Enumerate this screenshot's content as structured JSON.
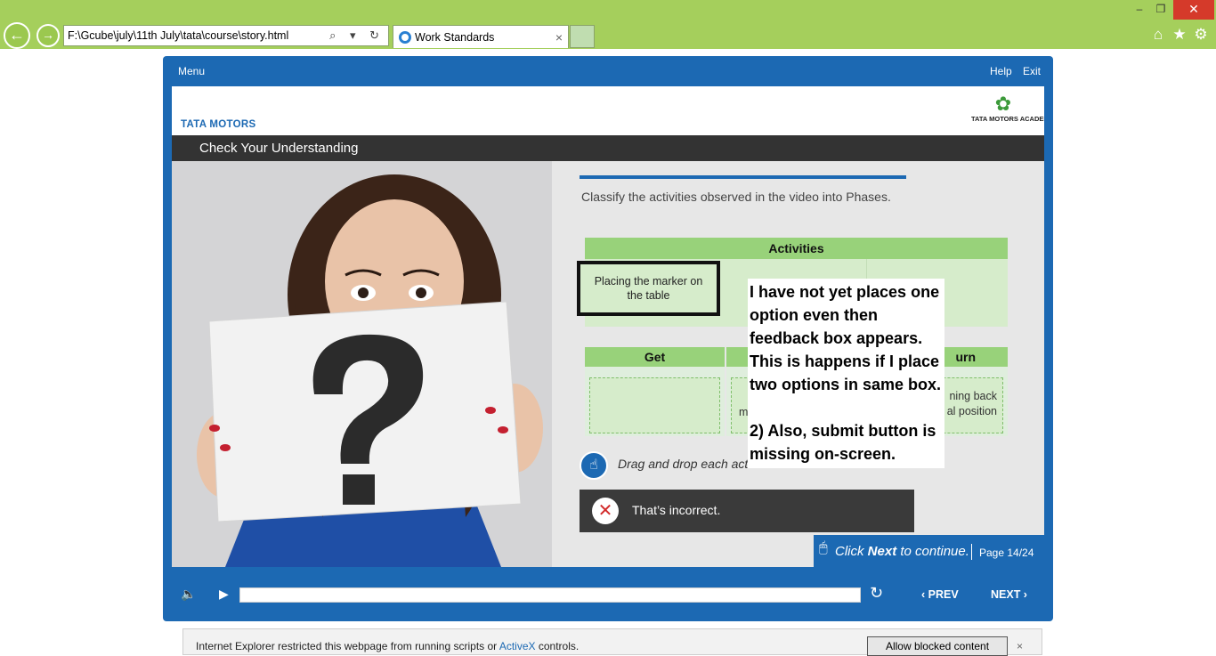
{
  "browser": {
    "address": "F:\\Gcube\\july\\11th July\\tata\\course\\story.html",
    "tab_title": "Work Standards",
    "addr_icons": "⌕ ▾ ↻",
    "tab_close": "×",
    "back": "←",
    "forward": "→",
    "win_min": "–",
    "win_max": "❐",
    "win_close": "✕",
    "home": "⌂",
    "favorites": "★",
    "settings": "⚙"
  },
  "player": {
    "menu_label": "Menu",
    "help_label": "Help",
    "exit_label": "Exit",
    "brand": "TATA MOTORS",
    "academy": "TATA MOTORS ACADEMY",
    "academy_tree": "✿",
    "slide_title": "Check Your Understanding"
  },
  "activity": {
    "instruction": "Classify the activities observed in the video into Phases.",
    "activities_header": "Activities",
    "card_label": "Placing the marker on the table",
    "phases": {
      "get": "Get",
      "mid": "",
      "return": "urn"
    },
    "mid_zone_text": "m",
    "return_zone_text": "ning back\nal position",
    "drag_text": "Drag and drop each acti",
    "hand_icon": "☝",
    "feedback_text": "That’s incorrect.",
    "feedback_icon": "✕"
  },
  "nextbar": {
    "mouse_icon": "🖱",
    "click_prefix": "Click ",
    "click_bold": "Next",
    "click_suffix": " to continue.",
    "page_label": "Page  14/24"
  },
  "annotation": {
    "text": "I have not yet places one option even then feedback box appears. This is happens if I place two options in same box.\n\n2) Also, submit button is missing on-screen."
  },
  "controls": {
    "volume_icon": "🔈",
    "play_icon": "▶",
    "replay_icon": "↻",
    "prev_label": "‹  PREV",
    "next_label": "NEXT  ›",
    "progress": 0
  },
  "notification": {
    "text_prefix": "Internet Explorer restricted this webpage from running scripts or ",
    "text_link": "ActiveX",
    "text_suffix": " controls.",
    "allow_label": "Allow blocked content",
    "close": "×"
  },
  "colors": {
    "browser_frame": "#a5cf5c",
    "player_blue": "#1c69b3",
    "title_bar": "#333333",
    "phase_green": "#98d27a",
    "zone_green": "#d6eccb",
    "feedback_bg": "#3a3a3a",
    "incorrect_red": "#d22a2a"
  }
}
